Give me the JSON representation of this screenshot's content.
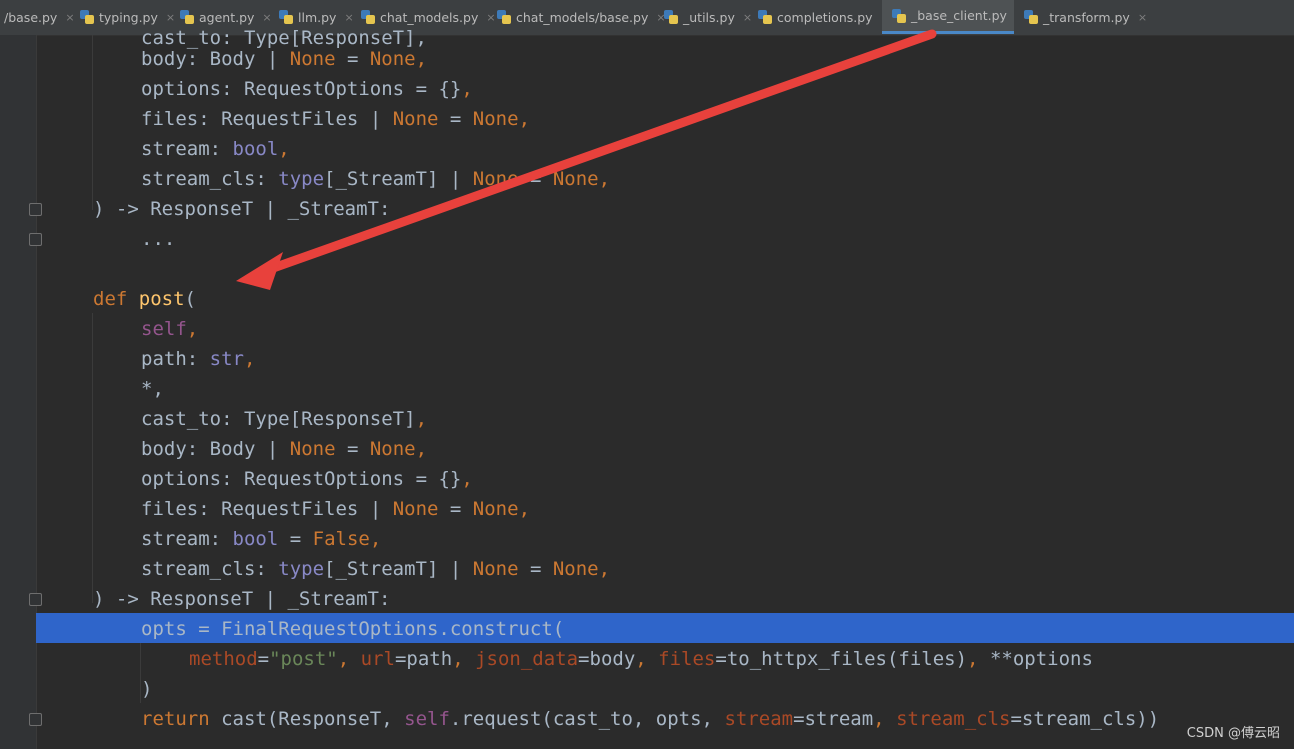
{
  "tabs": [
    {
      "label": "/base.py"
    },
    {
      "label": "typing.py"
    },
    {
      "label": "agent.py"
    },
    {
      "label": "llm.py"
    },
    {
      "label": "chat_models.py"
    },
    {
      "label": "chat_models/base.py"
    },
    {
      "label": "_utils.py"
    },
    {
      "label": "completions.py"
    },
    {
      "label": "_base_client.py",
      "active": true
    },
    {
      "label": "_transform.py"
    }
  ],
  "tab_close_glyph": "×",
  "code": {
    "partial_top": "cast_to: Type[ResponseT],",
    "t_body_name": "body",
    "t_body_type": "Body",
    "t_options_name": "options",
    "t_options_type": "RequestOptions",
    "t_options_default": "{}",
    "t_files_name": "files",
    "t_files_type": "RequestFiles",
    "t_stream_name": "stream",
    "t_stream_type": "bool",
    "t_streamcls_name": "stream_cls",
    "t_streamcls_type": "type",
    "t_streamcls_generic": "[_StreamT]",
    "ret1": "ResponseT | _StreamT:",
    "ellipsis": "...",
    "def_kw": "def",
    "fn_name": "post",
    "self_kw": "self",
    "path_name": "path",
    "path_type": "str",
    "star": "*,",
    "cast_to_name": "cast_to",
    "cast_to_type": "Type[ResponseT]",
    "none_kw": "None",
    "false_kw": "False",
    "ret2": "ResponseT | _StreamT:",
    "opts_lhs": "opts = FinalRequestOptions.construct(",
    "method_kw": "method",
    "method_val": "\"post\"",
    "url_kw": "url",
    "url_val": "path",
    "json_kw": "json_data",
    "json_val": "body",
    "files_kw": "files",
    "files_val": "to_httpx_files(files)",
    "kwargs": "**options",
    "close_paren": ")",
    "return_kw": "return",
    "ret_call_a": "cast(ResponseT, ",
    "ret_call_b": ".request(cast_to, opts, ",
    "stream_kw": "stream",
    "stream_val": "stream",
    "streamcls_kw": "stream_cls",
    "streamcls_val": "stream_cls))"
  },
  "annotation_arrow_color": "#e8413c",
  "watermark": "CSDN @傅云昭"
}
